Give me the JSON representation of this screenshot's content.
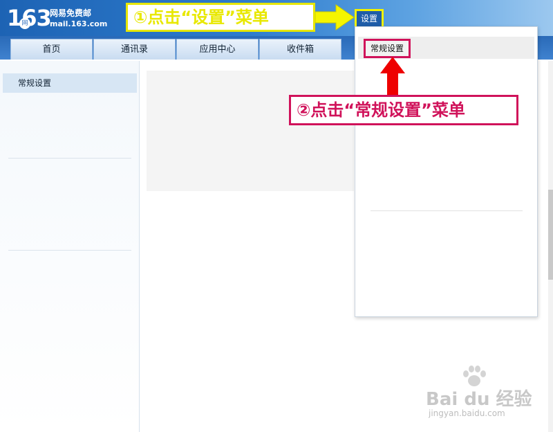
{
  "header": {
    "logo_number": "163",
    "logo_badge": "网",
    "brand_cn": "网易免费邮",
    "brand_en": "mail.163.com",
    "settings_label": "设置"
  },
  "nav": {
    "tabs": [
      {
        "label": "首页"
      },
      {
        "label": "通讯录"
      },
      {
        "label": "应用中心"
      },
      {
        "label": "收件箱"
      }
    ]
  },
  "sidebar": {
    "items": [
      {
        "label": "常规设置"
      }
    ]
  },
  "dropdown": {
    "items": [
      {
        "label": "常规设置"
      }
    ]
  },
  "annotations": {
    "step1": "①点击“设置”菜单",
    "step2": "②点击“常规设置”菜单"
  },
  "watermark": {
    "logo": "Bai du 经验",
    "url": "jingyan.baidu.com"
  },
  "colors": {
    "header_blue": "#2e7ccd",
    "highlight_yellow": "#e8e800",
    "annotation_red": "#d0125a"
  }
}
